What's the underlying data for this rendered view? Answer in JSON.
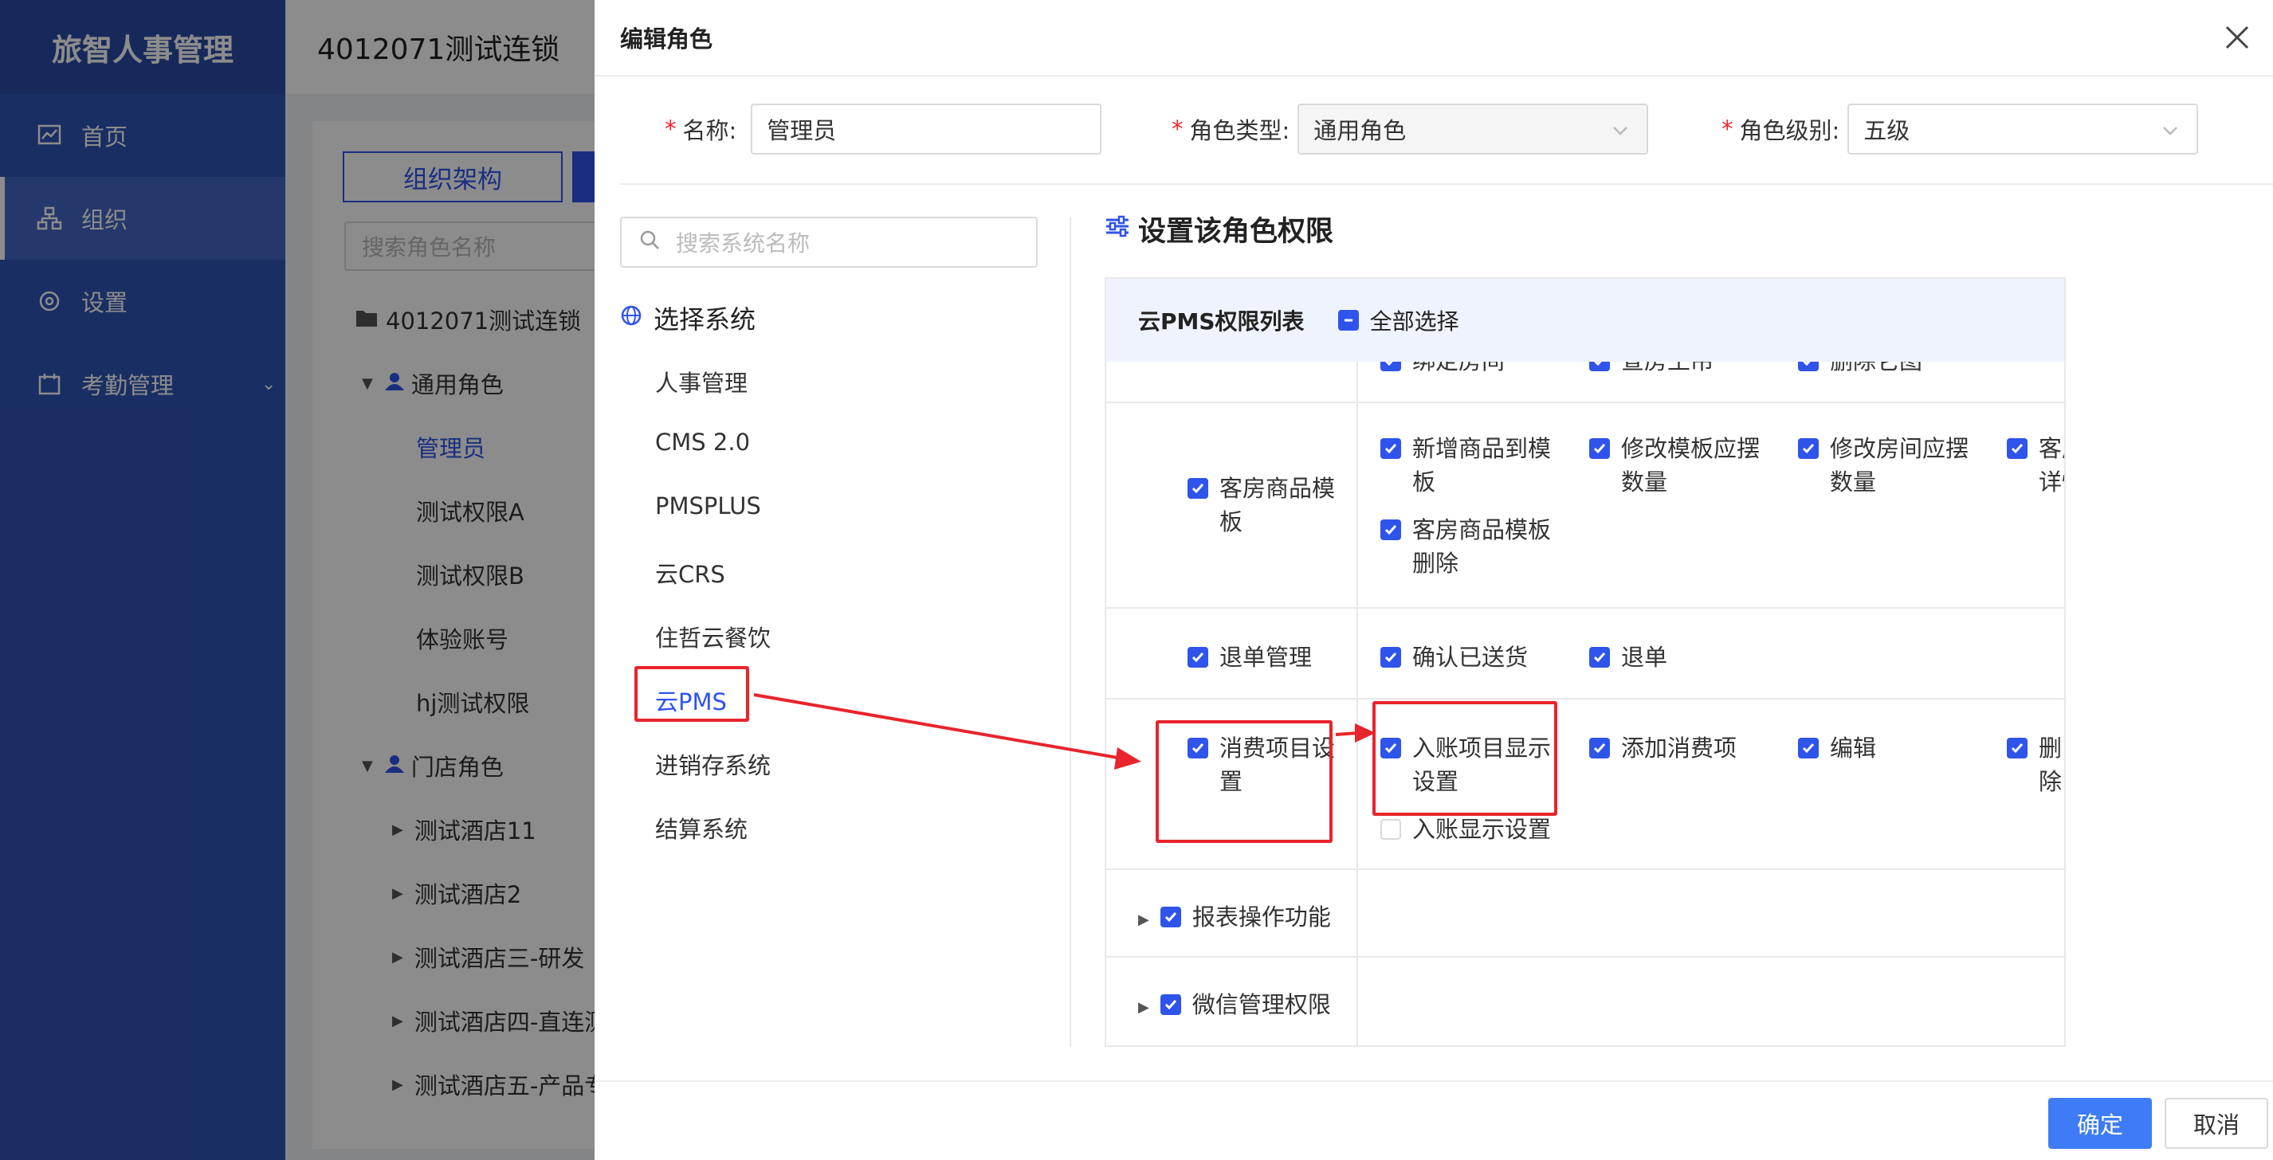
{
  "app": {
    "brand": "旅智人事管理",
    "company": "4012071测试连锁"
  },
  "sidebar": {
    "items": [
      {
        "label": "首页",
        "icon": "chart-icon"
      },
      {
        "label": "组织",
        "icon": "org-icon"
      },
      {
        "label": "设置",
        "icon": "settings-icon"
      },
      {
        "label": "考勤管理",
        "icon": "attendance-icon"
      }
    ]
  },
  "background": {
    "tab_org": "组织架构",
    "search_placeholder": "搜索角色名称",
    "tree": {
      "root": "4012071测试连锁",
      "group1": "通用角色",
      "g1_items": [
        "管理员",
        "测试权限A",
        "测试权限B",
        "体验账号",
        "hj测试权限"
      ],
      "group2": "门店角色",
      "g2_items": [
        "测试酒店11",
        "测试酒店2",
        "测试酒店三-研发",
        "测试酒店四-直连测",
        "测试酒店五-产品专"
      ]
    }
  },
  "drawer": {
    "title": "编辑角色",
    "form": {
      "name_label": "名称:",
      "name_value": "管理员",
      "type_label": "角色类型:",
      "type_value": "通用角色",
      "level_label": "角色级别:",
      "level_value": "五级"
    },
    "system_search_placeholder": "搜索系统名称",
    "system_title": "选择系统",
    "systems": [
      "人事管理",
      "CMS 2.0",
      "PMSPLUS",
      "云CRS",
      "住哲云餐饮",
      "云PMS",
      "进销存系统",
      "结算系统"
    ],
    "active_system": "云PMS",
    "perm_title": "设置该角色权限",
    "perm_list_title": "云PMS权限列表",
    "select_all": "全部选择",
    "cut_items": [
      "绑定房间",
      "查房王吊",
      "删除它图"
    ],
    "rows": {
      "room_goods": {
        "label": "客房商品模板",
        "items": [
          "新增商品到模板",
          "修改模板应摆数量",
          "修改房间应摆数量",
          "客房商品模板详情",
          "客房商品模板删除"
        ]
      },
      "refund": {
        "label": "退单管理",
        "items": [
          "确认已送货",
          "退单"
        ]
      },
      "consume": {
        "label": "消费项目设置",
        "items": [
          "入账项目显示设置",
          "添加消费项",
          "编辑",
          "删除",
          "入账显示设置"
        ]
      },
      "report": {
        "label": "报表操作功能"
      },
      "wechat": {
        "label": "微信管理权限"
      }
    },
    "ok": "确定",
    "cancel": "取消"
  },
  "colors": {
    "primary": "#2f54eb",
    "sidebar": "#2f54b5",
    "annotation": "#e8242c"
  }
}
